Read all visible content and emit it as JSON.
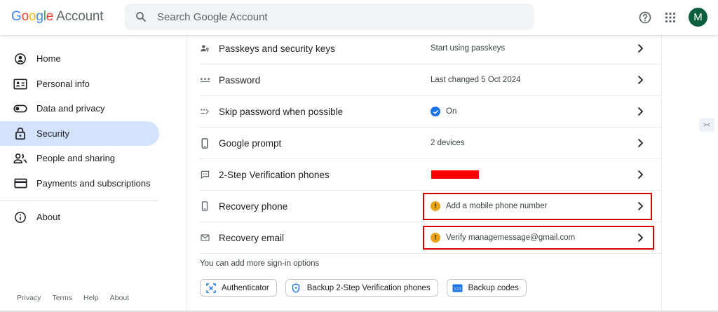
{
  "header": {
    "logo_google": [
      "G",
      "o",
      "o",
      "g",
      "l",
      "e"
    ],
    "logo_account": "Account",
    "search_placeholder": "Search Google Account",
    "avatar_letter": "M"
  },
  "sidebar": {
    "items": [
      {
        "label": "Home",
        "icon": "home-icon"
      },
      {
        "label": "Personal info",
        "icon": "id-card-icon"
      },
      {
        "label": "Data and privacy",
        "icon": "toggle-icon"
      },
      {
        "label": "Security",
        "icon": "lock-icon",
        "active": true
      },
      {
        "label": "People and sharing",
        "icon": "people-icon"
      },
      {
        "label": "Payments and subscriptions",
        "icon": "credit-card-icon"
      },
      {
        "label": "About",
        "icon": "info-icon"
      }
    ],
    "footer": [
      "Privacy",
      "Terms",
      "Help",
      "About"
    ]
  },
  "signin": {
    "rows": [
      {
        "label": "Passkeys and security keys",
        "value": "Start using passkeys",
        "icon": "passkey-icon"
      },
      {
        "label": "Password",
        "value": "Last changed 5 Oct 2024",
        "icon": "password-dots-icon"
      },
      {
        "label": "Skip password when possible",
        "value": "On",
        "icon": "skip-password-icon",
        "status": "check"
      },
      {
        "label": "Google prompt",
        "value": "2 devices",
        "icon": "phone-icon"
      },
      {
        "label": "2-Step Verification phones",
        "value": "",
        "icon": "sms-icon",
        "redacted": true
      },
      {
        "label": "Recovery phone",
        "value": "Add a mobile phone number",
        "icon": "mobile-icon",
        "status": "warning"
      },
      {
        "label": "Recovery email",
        "value": "Verify managemessage@gmail.com",
        "icon": "mail-icon",
        "status": "warning"
      }
    ],
    "more_options": "You can add more sign-in options",
    "chips": [
      {
        "label": "Authenticator",
        "icon": "authenticator-icon"
      },
      {
        "label": "Backup 2-Step Verification phones",
        "icon": "shield-icon"
      },
      {
        "label": "Backup codes",
        "icon": "backup-codes-icon"
      }
    ]
  },
  "colors": {
    "active_nav": "#d3e3fd",
    "check_blue": "#1a73e8",
    "warning_amber": "#e8a317",
    "highlight_red": "#d00000",
    "avatar": "#0b5e3f"
  }
}
